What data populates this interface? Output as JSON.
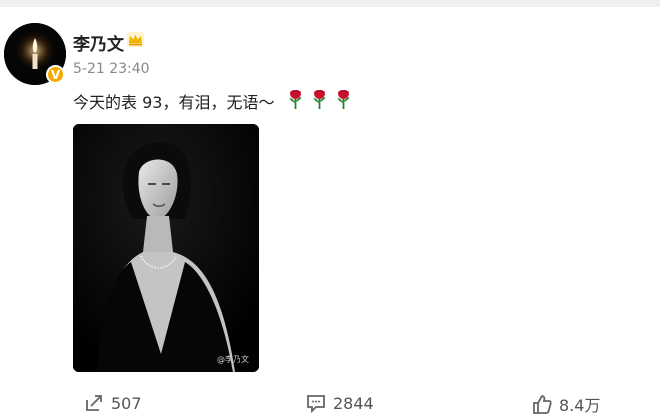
{
  "post": {
    "author_name": "李乃文",
    "time": "5-21 23:40",
    "text": "今天的表 93，有泪，无语～",
    "image_watermark": "@李乃文"
  },
  "actions": {
    "repost_count": "507",
    "comment_count": "2844",
    "like_count": "8.4万"
  },
  "colors": {
    "verified_badge": "#f5a800",
    "crown": "#f0b400",
    "rose": "#c8102e"
  },
  "icons": [
    "candle-avatar",
    "verified-icon",
    "crown-icon",
    "rose-icon",
    "repost-icon",
    "comment-icon",
    "like-icon"
  ]
}
